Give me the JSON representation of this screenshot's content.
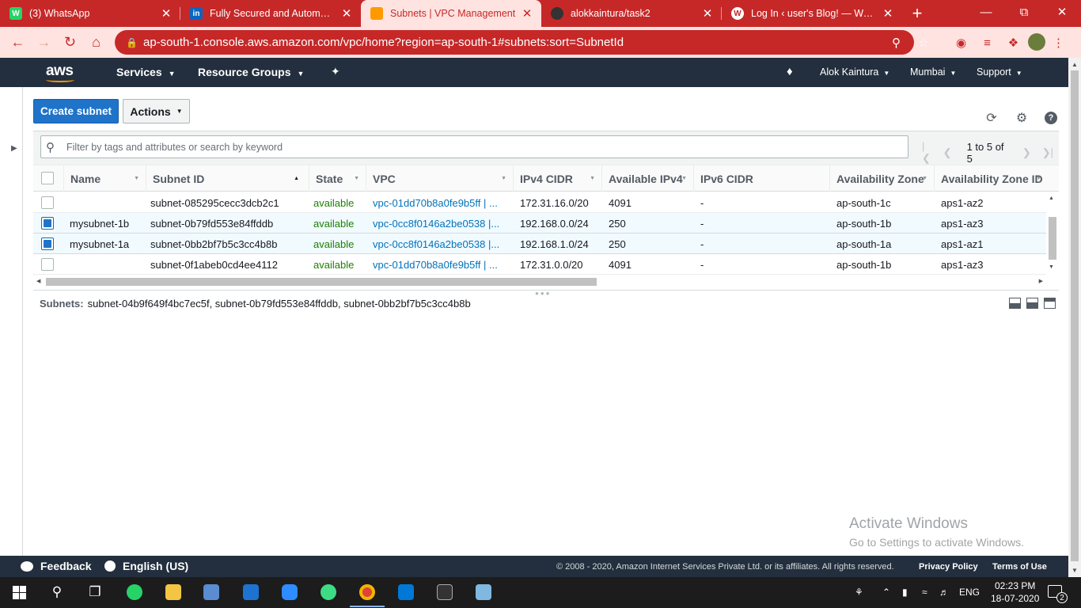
{
  "browser": {
    "tabs": [
      {
        "title": "(3) WhatsApp",
        "favicon_color": "#25d366",
        "favicon": "whatsapp-icon",
        "fav_text": "W"
      },
      {
        "title": "Fully Secured and Automated",
        "favicon_color": "#0a66c2",
        "favicon": "linkedin-icon",
        "fav_text": "in"
      },
      {
        "title": "Subnets | VPC Management",
        "favicon_color": "#ff9900",
        "favicon": "aws-icon",
        "fav_text": ""
      },
      {
        "title": "alokkaintura/task2",
        "favicon_color": "#333333",
        "favicon": "github-icon",
        "fav_text": ""
      },
      {
        "title": "Log In ‹ user's Blog! — Word",
        "favicon_color": "#ffffff",
        "favicon": "wordpress-icon",
        "fav_text": "W"
      }
    ],
    "active_tab_index": 2,
    "url": "ap-south-1.console.aws.amazon.com/vpc/home?region=ap-south-1#subnets:sort=SubnetId"
  },
  "aws_nav": {
    "logo": "aws",
    "services": "Services",
    "resource_groups": "Resource Groups",
    "user": "Alok Kaintura",
    "region": "Mumbai",
    "support": "Support"
  },
  "toolbar": {
    "create_label": "Create subnet",
    "actions_label": "Actions"
  },
  "filter": {
    "placeholder": "Filter by tags and attributes or search by keyword",
    "pagination": "1 to 5 of 5"
  },
  "table": {
    "columns": [
      "Name",
      "Subnet ID",
      "State",
      "VPC",
      "IPv4 CIDR",
      "Available IPv4",
      "IPv6 CIDR",
      "Availability Zone",
      "Availability Zone ID"
    ],
    "rows": [
      {
        "selected": false,
        "name": "",
        "subnet_id": "subnet-085295cecc3dcb2c1",
        "state": "available",
        "vpc": "vpc-01dd70b8a0fe9b5ff | ...",
        "ipv4": "172.31.16.0/20",
        "avail": "4091",
        "ipv6": "-",
        "az": "ap-south-1c",
        "azid": "aps1-az2"
      },
      {
        "selected": true,
        "name": "mysubnet-1b",
        "subnet_id": "subnet-0b79fd553e84ffddb",
        "state": "available",
        "vpc": "vpc-0cc8f0146a2be0538 |...",
        "ipv4": "192.168.0.0/24",
        "avail": "250",
        "ipv6": "-",
        "az": "ap-south-1b",
        "azid": "aps1-az3"
      },
      {
        "selected": true,
        "name": "mysubnet-1a",
        "subnet_id": "subnet-0bb2bf7b5c3cc4b8b",
        "state": "available",
        "vpc": "vpc-0cc8f0146a2be0538 |...",
        "ipv4": "192.168.1.0/24",
        "avail": "250",
        "ipv6": "-",
        "az": "ap-south-1a",
        "azid": "aps1-az1"
      },
      {
        "selected": false,
        "name": "",
        "subnet_id": "subnet-0f1abeb0cd4ee4112",
        "state": "available",
        "vpc": "vpc-01dd70b8a0fe9b5ff | ...",
        "ipv4": "172.31.0.0/20",
        "avail": "4091",
        "ipv6": "-",
        "az": "ap-south-1b",
        "azid": "aps1-az3"
      }
    ]
  },
  "details": {
    "label": "Subnets:",
    "value": "subnet-04b9f649f4bc7ec5f, subnet-0b79fd553e84ffddb, subnet-0bb2bf7b5c3cc4b8b"
  },
  "watermark": {
    "line1": "Activate Windows",
    "line2": "Go to Settings to activate Windows."
  },
  "footer": {
    "feedback": "Feedback",
    "language": "English (US)",
    "copyright": "© 2008 - 2020, Amazon Internet Services Private Ltd. or its affiliates. All rights reserved.",
    "privacy": "Privacy Policy",
    "terms": "Terms of Use"
  },
  "taskbar": {
    "lang": "ENG",
    "time": "02:23 PM",
    "date": "18-07-2020",
    "notifications": "2"
  },
  "colors": {
    "chrome_theme": "#c62828",
    "aws_nav": "#232f3e",
    "primary_button": "#1f73c9",
    "state_available": "#1d8102",
    "link": "#0073bb"
  }
}
